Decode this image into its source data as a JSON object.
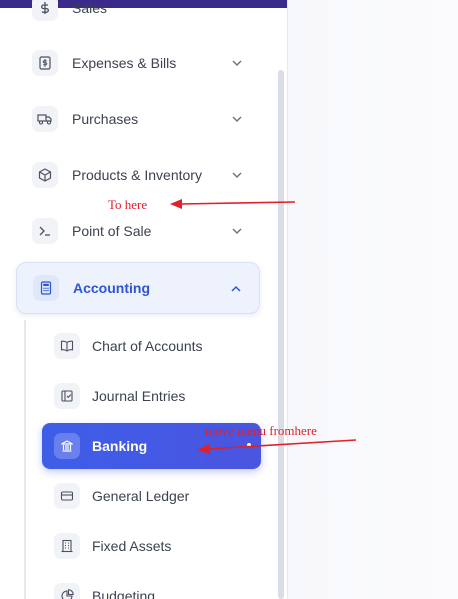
{
  "sidebar": {
    "items": [
      {
        "label": "Sales",
        "icon": "dollar-icon"
      },
      {
        "label": "Expenses & Bills",
        "icon": "receipt-dollar-icon"
      },
      {
        "label": "Purchases",
        "icon": "truck-icon"
      },
      {
        "label": "Products & Inventory",
        "icon": "box-icon"
      },
      {
        "label": "Point of Sale",
        "icon": "terminal-icon"
      },
      {
        "label": "Accounting",
        "icon": "calculator-icon",
        "active": true
      }
    ],
    "accounting_sub": [
      {
        "label": "Chart of Accounts",
        "icon": "book-icon"
      },
      {
        "label": "Journal Entries",
        "icon": "journal-icon"
      },
      {
        "label": "Banking",
        "icon": "bank-icon",
        "active": true
      },
      {
        "label": "General Ledger",
        "icon": "card-icon"
      },
      {
        "label": "Fixed Assets",
        "icon": "building-icon"
      },
      {
        "label": "Budgeting",
        "icon": "pie-icon"
      }
    ]
  },
  "annotations": {
    "to_here": "To here",
    "move_from": "move menu fromhere"
  },
  "colors": {
    "accent": "#3e5ee8",
    "annotation": "#e0202a",
    "topbar": "#3b2a8a"
  }
}
